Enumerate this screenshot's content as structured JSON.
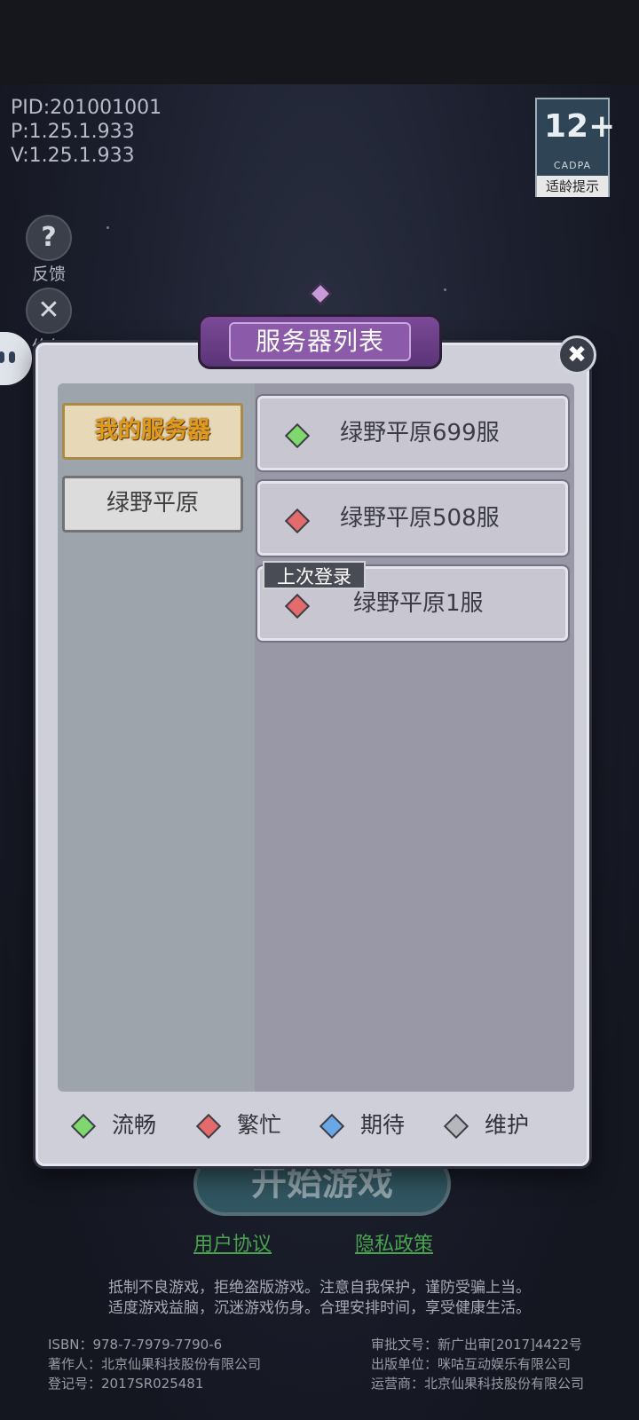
{
  "info": {
    "pid": "PID:201001001",
    "p": "P:1.25.1.933",
    "v": "V:1.25.1.933"
  },
  "age_badge": {
    "number": "12+",
    "org": "CADPA",
    "tip": "适龄提示"
  },
  "side": {
    "feedback_label": "反馈",
    "repair_label": "修复"
  },
  "modal": {
    "title": "服务器列表",
    "close_glyph": "✖",
    "categories": [
      {
        "label": "我的服务器",
        "selected": true
      },
      {
        "label": "绿野平原",
        "selected": false
      }
    ],
    "servers": [
      {
        "name": "绿野平原699服",
        "status": "流畅",
        "color": "#7fd86e"
      },
      {
        "name": "绿野平原508服",
        "status": "繁忙",
        "color": "#e36b6b"
      },
      {
        "name": "绿野平原1服",
        "status": "繁忙",
        "color": "#e36b6b",
        "tag": "上次登录"
      }
    ],
    "legend": [
      {
        "label": "流畅",
        "color": "#7fd86e"
      },
      {
        "label": "繁忙",
        "color": "#e36b6b"
      },
      {
        "label": "期待",
        "color": "#6aa7e6"
      },
      {
        "label": "维护",
        "color": "#b6b7bc"
      }
    ]
  },
  "start_button": "开始游戏",
  "links": {
    "user_agreement": "用户协议",
    "privacy_policy": "隐私政策"
  },
  "notice": {
    "line1": "抵制不良游戏，拒绝盗版游戏。注意自我保护，谨防受骗上当。",
    "line2": "适度游戏益脑，沉迷游戏伤身。合理安排时间，享受健康生活。"
  },
  "credits": {
    "left": [
      "ISBN：978-7-7979-7790-6",
      "著作人：北京仙果科技股份有限公司",
      "登记号：2017SR025481"
    ],
    "right": [
      "审批文号：新广出审[2017]4422号",
      "出版单位：咪咕互动娱乐有限公司",
      "运营商：北京仙果科技股份有限公司"
    ]
  }
}
